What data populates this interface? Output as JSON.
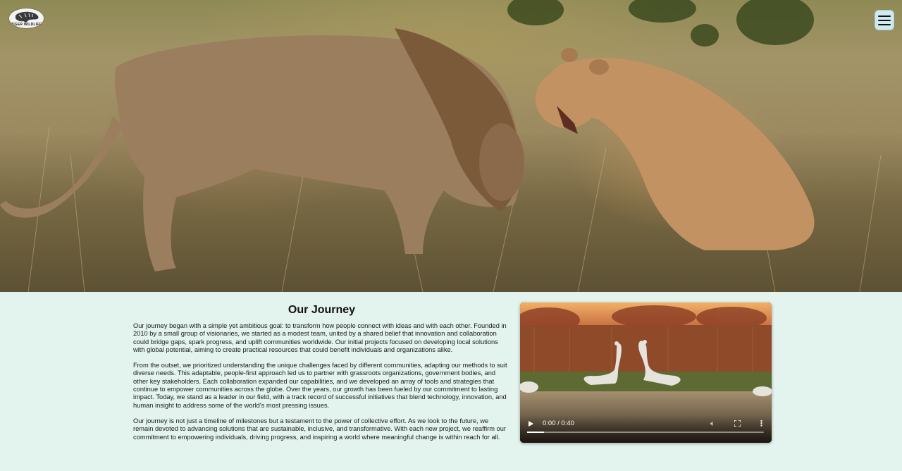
{
  "header": {
    "logo_text": "TIGER WILDLIFE",
    "menu_label": "Menu"
  },
  "hero": {
    "image_subject": "lion and lioness in grassland"
  },
  "article": {
    "title": "Our Journey",
    "paragraphs": [
      "Our journey began with a simple yet ambitious goal: to transform how people connect with ideas and with each other. Founded in 2010 by a small group of visionaries, we started as a modest team, united by a shared belief that innovation and collaboration could bridge gaps, spark progress, and uplift communities worldwide. Our initial projects focused on developing local solutions with global potential, aiming to create practical resources that could benefit individuals and organizations alike.",
      "From the outset, we prioritized understanding the unique challenges faced by different communities, adapting our methods to suit diverse needs. This adaptable, people-first approach led us to partner with grassroots organizations, government bodies, and other key stakeholders. Each collaboration expanded our capabilities, and we developed an array of tools and strategies that continue to empower communities across the globe. Over the years, our growth has been fueled by our commitment to lasting impact. Today, we stand as a leader in our field, with a track record of successful initiatives that blend technology, innovation, and human insight to address some of the world's most pressing issues.",
      "Our journey is not just a timeline of milestones but a testament to the power of collective effort. As we look to the future, we remain devoted to advancing solutions that are sustainable, inclusive, and transformative. With each new project, we reaffirm our commitment to empowering individuals, driving progress, and inspiring a world where meaningful change is within reach for all."
    ]
  },
  "video": {
    "time": "0:00 / 0:40",
    "progress": 0.07,
    "icons": [
      "play-icon",
      "volume-icon",
      "fullscreen-icon",
      "more-options-icon"
    ]
  }
}
